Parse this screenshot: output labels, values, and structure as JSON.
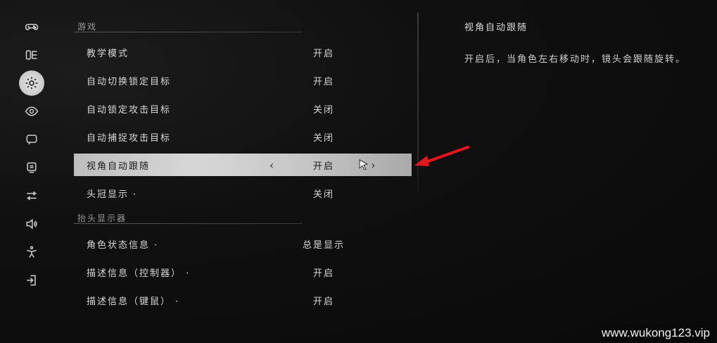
{
  "sidebar": {
    "items": [
      {
        "icon": "gamepad-icon"
      },
      {
        "icon": "book-icon"
      },
      {
        "icon": "gear-icon",
        "active": true
      },
      {
        "icon": "eye-icon"
      },
      {
        "icon": "chat-icon"
      },
      {
        "icon": "monitor-icon"
      },
      {
        "icon": "sliders-icon"
      },
      {
        "icon": "speaker-icon"
      },
      {
        "icon": "accessibility-icon"
      },
      {
        "icon": "exit-icon"
      }
    ]
  },
  "sections": [
    {
      "title": "游戏",
      "rows": [
        {
          "label": "教学模式",
          "value": "开启"
        },
        {
          "label": "自动切换锁定目标",
          "value": "开启"
        },
        {
          "label": "自动锁定攻击目标",
          "value": "关闭"
        },
        {
          "label": "自动捕捉攻击目标",
          "value": "关闭"
        },
        {
          "label": "视角自动跟随",
          "value": "开启",
          "selected": true
        },
        {
          "label": "头冠显示 ·",
          "value": "关闭"
        }
      ]
    },
    {
      "title": "抬头显示器",
      "rows": [
        {
          "label": "角色状态信息 ·",
          "value": "总是显示"
        },
        {
          "label": "描述信息（控制器） ·",
          "value": "开启"
        },
        {
          "label": "描述信息（键鼠） ·",
          "value": "开启"
        }
      ]
    }
  ],
  "arrows": {
    "left": "‹",
    "right": "›"
  },
  "description": {
    "title": "视角自动跟随",
    "body": "开启后，当角色左右移动时，镜头会跟随旋转。"
  },
  "watermark": "www.wukong123.vip",
  "colors": {
    "annotation_arrow": "#e8141e",
    "selected_bg": "#cfcfcf"
  }
}
